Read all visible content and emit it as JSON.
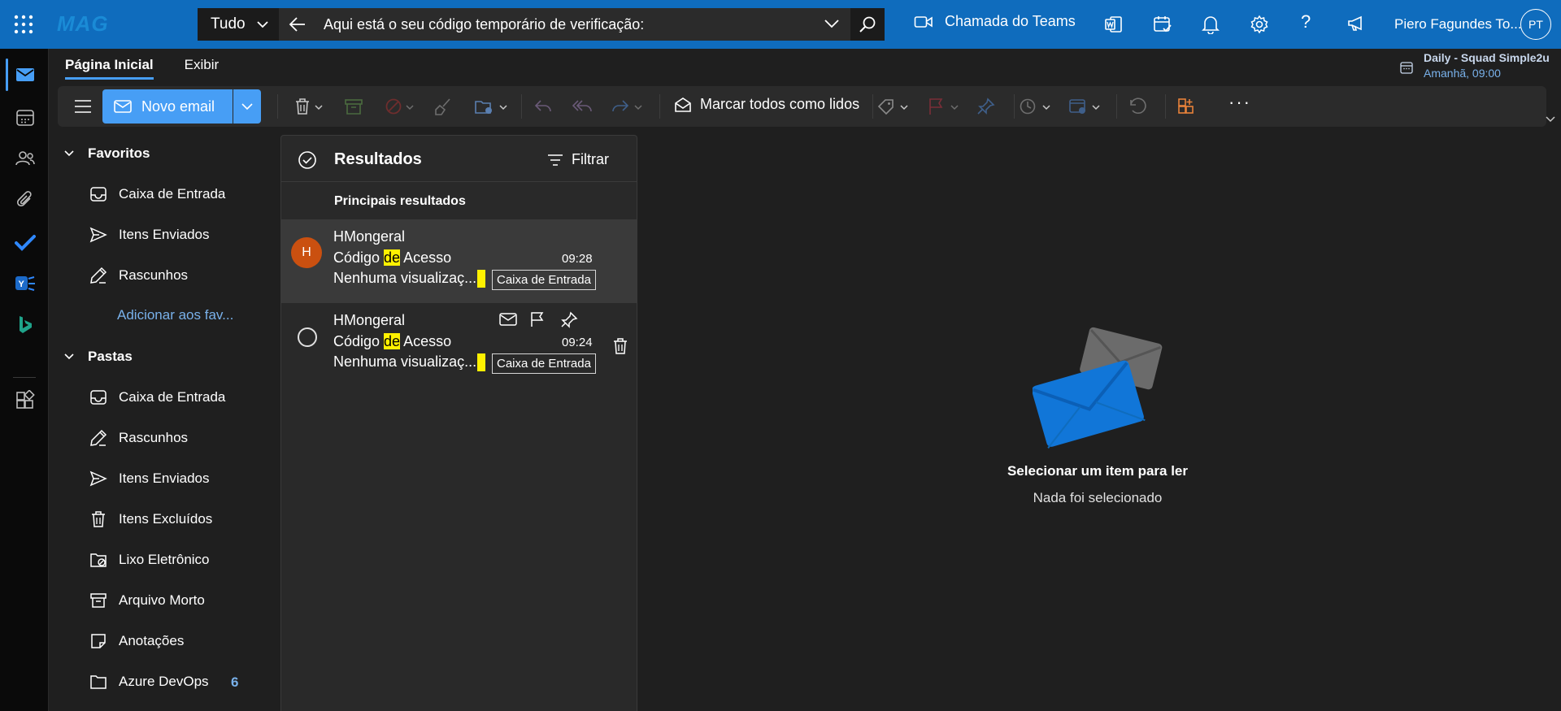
{
  "app": {
    "brand": "MAG"
  },
  "search": {
    "scope": "Tudo",
    "query": "Aqui está o seu código temporário de verificação:"
  },
  "header": {
    "teams_call": "Chamada do Teams",
    "user_name": "Piero Fagundes To...",
    "user_initials": "PT"
  },
  "ribbon": {
    "tabs": [
      "Página Inicial",
      "Exibir"
    ],
    "new_email": "Novo email",
    "mark_all_read": "Marcar todos como lidos",
    "more": "···"
  },
  "meeting": {
    "title": "Daily - Squad Simple2u",
    "time": "Amanhã, 09:00"
  },
  "folders": {
    "favorites_label": "Favoritos",
    "favorites": [
      "Caixa de Entrada",
      "Itens Enviados",
      "Rascunhos"
    ],
    "add_favorite": "Adicionar aos fav...",
    "folders_label": "Pastas",
    "items": [
      "Caixa de Entrada",
      "Rascunhos",
      "Itens Enviados",
      "Itens Excluídos",
      "Lixo Eletrônico",
      "Arquivo Morto",
      "Anotações",
      "Azure DevOps"
    ],
    "azure_count": "6"
  },
  "list": {
    "title": "Resultados",
    "filter": "Filtrar",
    "section": "Principais resultados",
    "messages": [
      {
        "avatar": "H",
        "sender": "HMongeral",
        "subject_pre": "Código ",
        "subject_hl": "de",
        "subject_post": " Acesso",
        "preview": "Nenhuma visualizaç...",
        "time": "09:28",
        "folder": "Caixa de Entrada"
      },
      {
        "sender": "HMongeral",
        "subject_pre": "Código ",
        "subject_hl": "de",
        "subject_post": " Acesso",
        "preview": "Nenhuma visualizaç...",
        "time": "09:24",
        "folder": "Caixa de Entrada"
      }
    ]
  },
  "reading": {
    "empty_title": "Selecionar um item para ler",
    "empty_subtitle": "Nada foi selecionado"
  },
  "colors": {
    "accent": "#479ef5",
    "topbar": "#0f6cbd",
    "highlight": "#fff100",
    "avatar": "#ca5010"
  }
}
